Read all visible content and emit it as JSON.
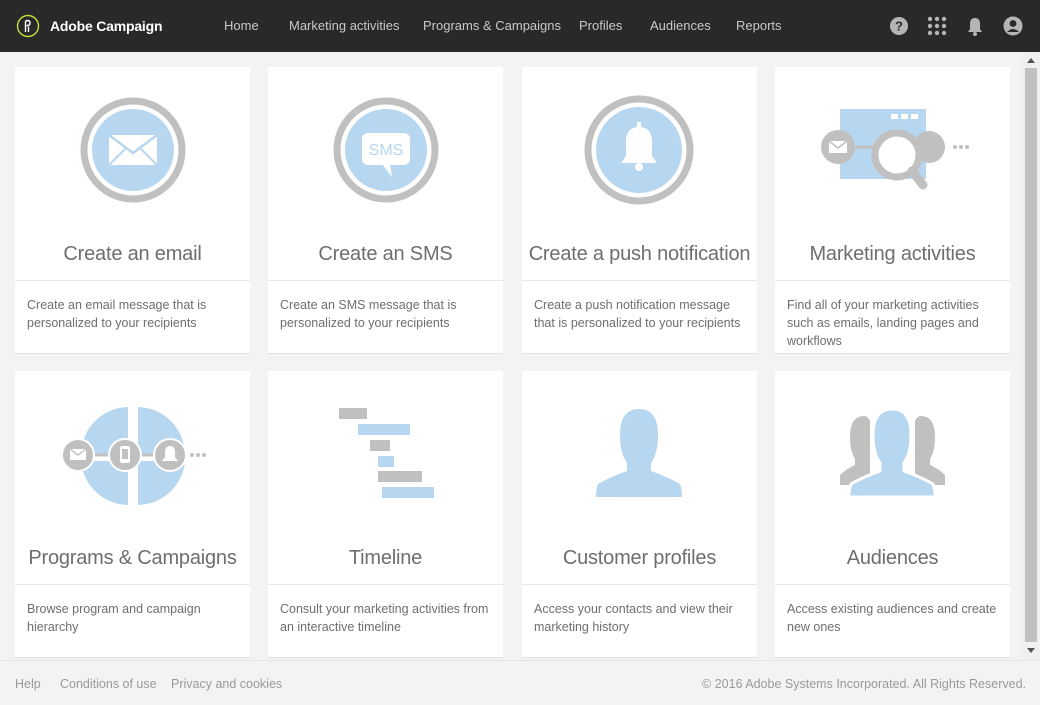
{
  "header": {
    "brand": "Adobe Campaign",
    "nav": [
      "Home",
      "Marketing activities",
      "Programs & Campaigns",
      "Profiles",
      "Audiences",
      "Reports"
    ],
    "icons": [
      "help-icon",
      "apps-grid-icon",
      "notifications-bell-icon",
      "user-avatar-icon"
    ]
  },
  "cards": [
    {
      "title": "Create an email",
      "desc": "Create an email message that is personalized to your recipients",
      "icon": "email-icon"
    },
    {
      "title": "Create an SMS",
      "desc": "Create an SMS message that is personalized to your recipients",
      "icon": "sms-icon",
      "icon_text": "SMS"
    },
    {
      "title": "Create a push notification",
      "desc": "Create a push notification message that is personalized to your recipients",
      "icon": "bell-icon"
    },
    {
      "title": "Marketing activities",
      "desc": "Find all of your marketing activities such as emails, landing pages and workflows",
      "icon": "marketing-search-icon"
    },
    {
      "title": "Programs & Campaigns",
      "desc": "Browse program and campaign hierarchy",
      "icon": "programs-campaigns-icon"
    },
    {
      "title": "Timeline",
      "desc": "Consult your marketing activities from an interactive timeline",
      "icon": "timeline-icon"
    },
    {
      "title": "Customer profiles",
      "desc": "Access your contacts and view their marketing history",
      "icon": "profile-icon"
    },
    {
      "title": "Audiences",
      "desc": "Access existing audiences and create new ones",
      "icon": "audiences-icon"
    }
  ],
  "footer": {
    "links": [
      "Help",
      "Conditions of use",
      "Privacy and cookies"
    ],
    "copyright": "© 2016 Adobe Systems Incorporated. All Rights Reserved."
  },
  "colors": {
    "header_bg": "#292929",
    "brand_accent": "#c4df3a",
    "icon_blue": "#b7d6ef",
    "icon_grey": "#c0c0c0"
  }
}
